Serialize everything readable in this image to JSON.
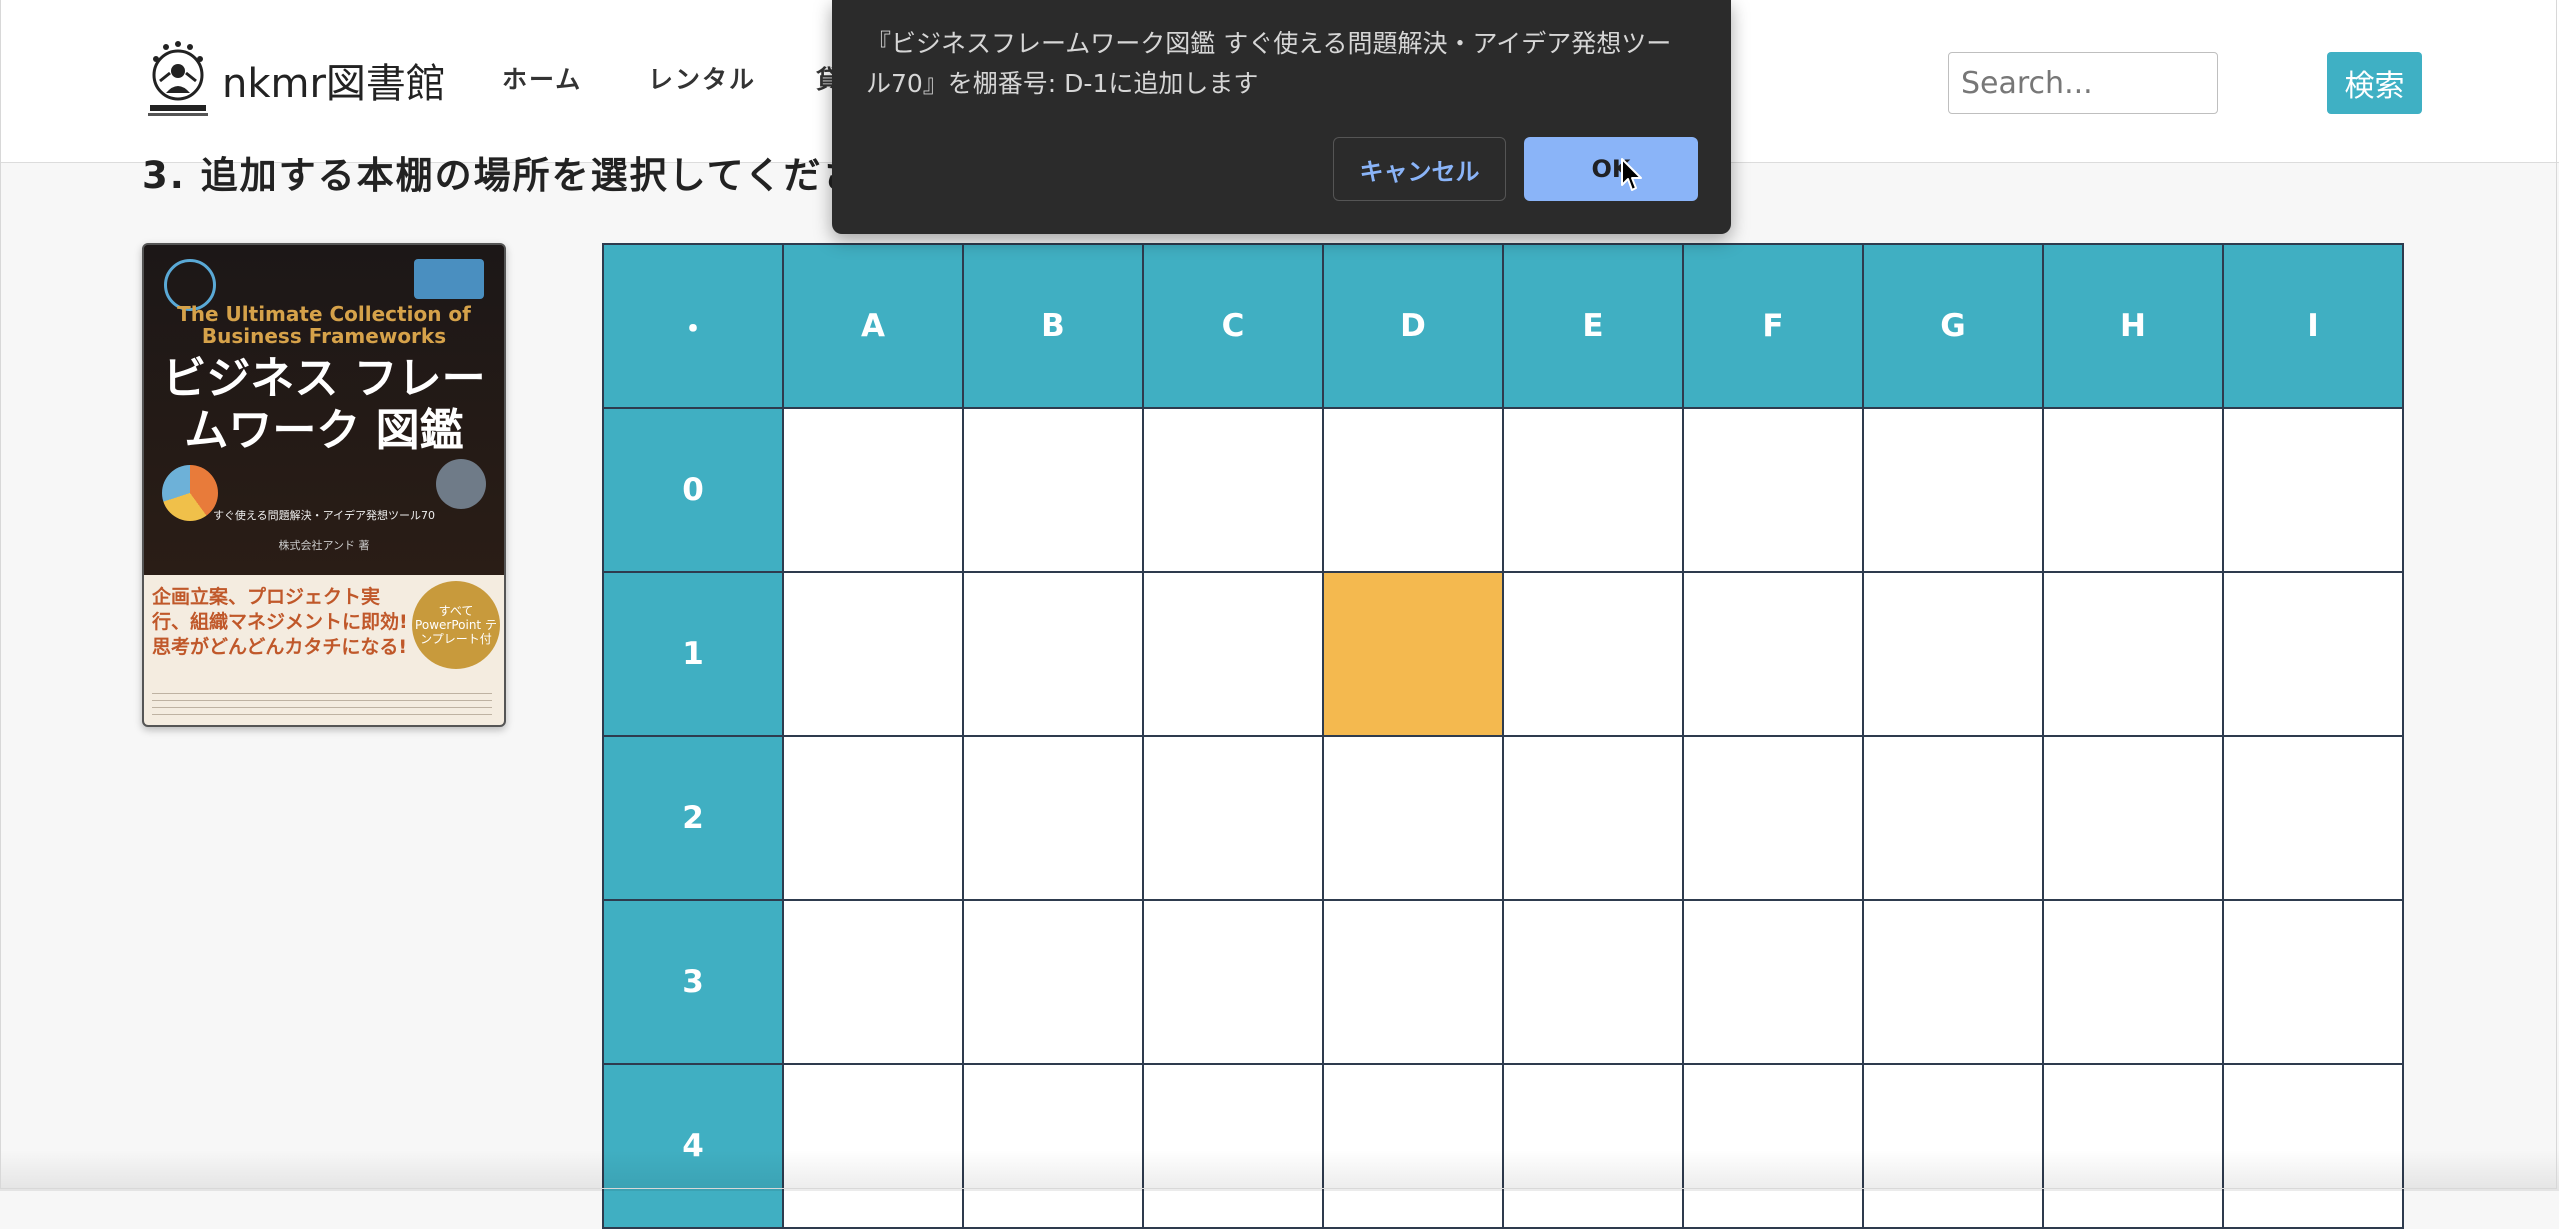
{
  "brand": {
    "name": "nkmr図書館",
    "logo_icon": "juggler-logo-icon"
  },
  "nav": {
    "items": [
      "ホーム",
      "レンタル",
      "貸"
    ]
  },
  "search": {
    "placeholder": "Search...",
    "button_label": "検索"
  },
  "page": {
    "step_heading": "3. 追加する本棚の場所を選択してくださ"
  },
  "book": {
    "cover_en": "The Ultimate Collection of Business Frameworks",
    "cover_title": "ビジネス フレームワーク 図鑑",
    "cover_subtitle": "すぐ使える問題解決・アイデア発想ツール70",
    "cover_author": "株式会社アンド 著",
    "cover_blurb": "企画立案、プロジェクト実行、組織マネジメントに即効!思考がどんどんカタチになる!",
    "cover_badge": "すべて PowerPoint テンプレート付"
  },
  "shelf": {
    "corner": "・",
    "columns": [
      "A",
      "B",
      "C",
      "D",
      "E",
      "F",
      "G",
      "H",
      "I"
    ],
    "rows": [
      "0",
      "1",
      "2",
      "3",
      "4"
    ],
    "selected": {
      "row": "1",
      "column": "D"
    },
    "selected_color": "#f4b94f",
    "header_color": "#40afc2"
  },
  "dialog": {
    "message": "『ビジネスフレームワーク図鑑 すぐ使える問題解決・アイデア発想ツール70』を棚番号: D-1に追加します",
    "cancel_label": "キャンセル",
    "ok_label": "OK"
  }
}
